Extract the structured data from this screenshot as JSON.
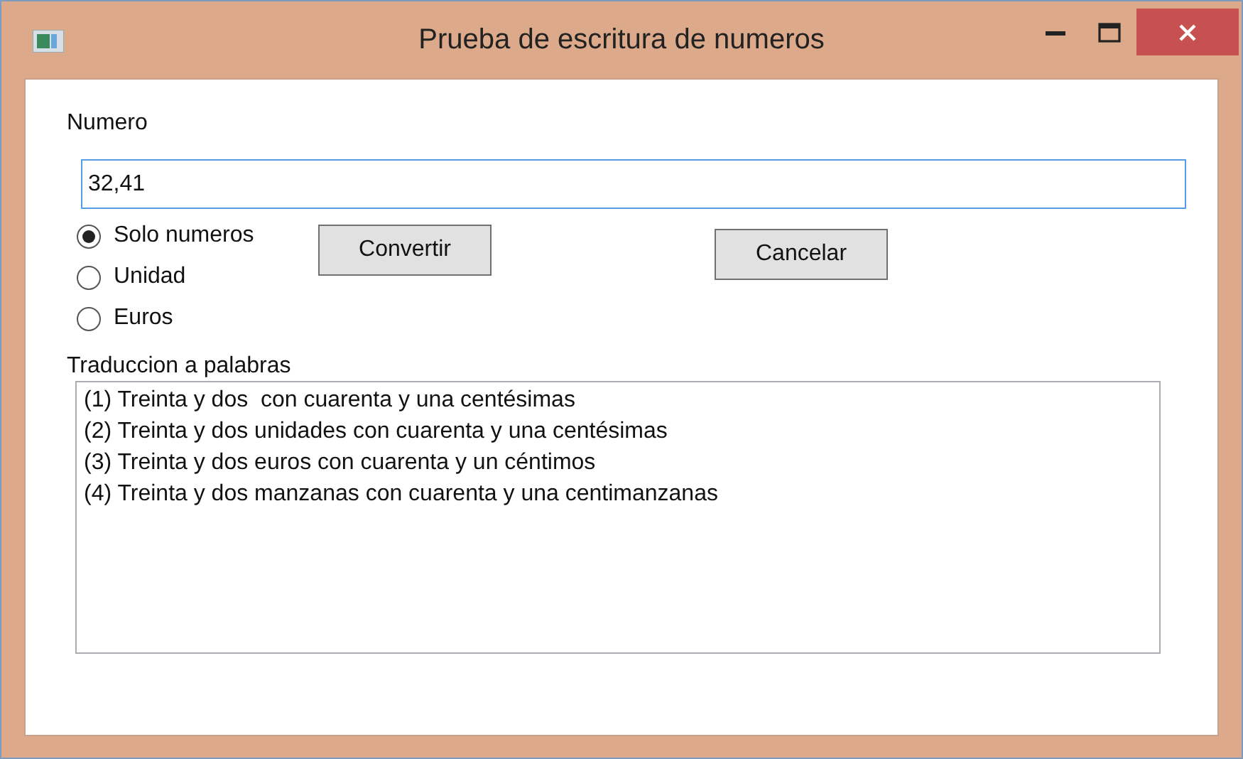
{
  "window": {
    "title": "Prueba de escritura de numeros"
  },
  "number_label": "Numero",
  "number_field": {
    "value": "32,41",
    "focused": true
  },
  "options": [
    {
      "label": "Solo numeros",
      "selected": true
    },
    {
      "label": "Unidad",
      "selected": false
    },
    {
      "label": "Euros",
      "selected": false
    }
  ],
  "buttons": [
    "Convertir",
    "Cancelar"
  ],
  "output_label": "Traduccion a palabras",
  "output_lines": [
    "(1) Treinta y dos  con cuarenta y una centésimas",
    "(2) Treinta y dos unidades con cuarenta y una centésimas",
    "(3) Treinta y dos euros con cuarenta y un céntimos",
    "(4) Treinta y dos manzanas con cuarenta y una centimanzanas"
  ]
}
